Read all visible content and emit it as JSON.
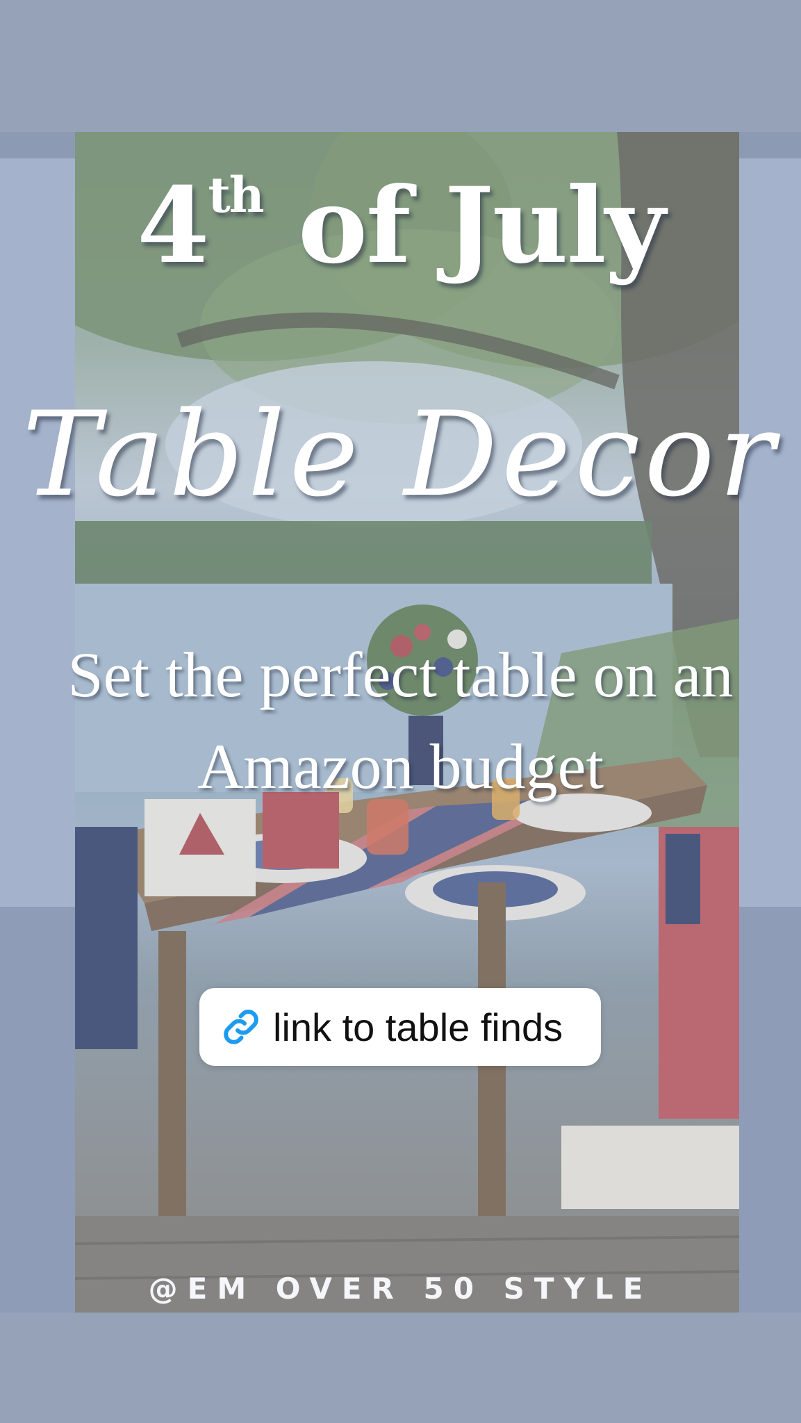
{
  "story": {
    "title_number": "4",
    "title_suffix": "th",
    "title_rest": "of July",
    "title_script": "Table Decor",
    "subtitle_line1": "Set the perfect table on an",
    "subtitle_line2": "Amazon budget",
    "link_label": "link to table finds",
    "link_icon": "link-icon",
    "handle": "@EM OVER 50 STYLE"
  },
  "colors": {
    "background": "#95a2b7",
    "link_icon": "#1d9bf0",
    "text": "#ffffff"
  }
}
